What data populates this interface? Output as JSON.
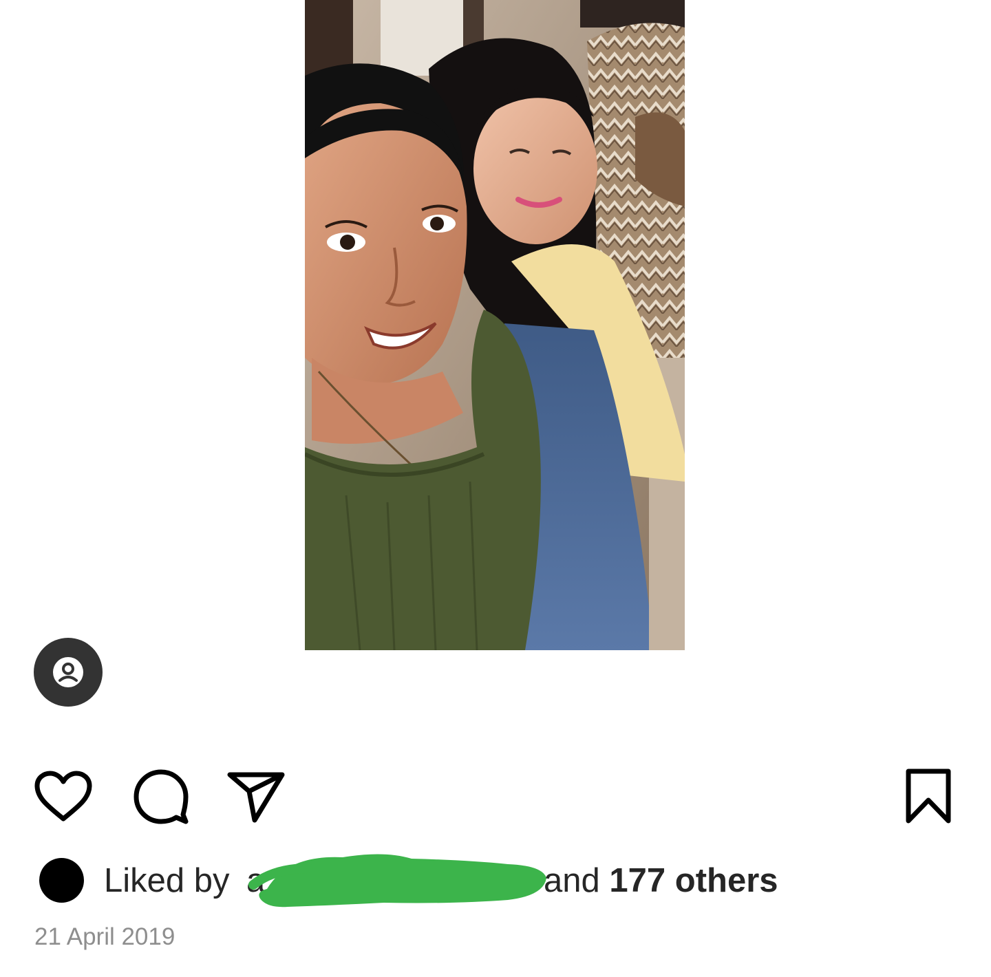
{
  "post": {
    "photo_icon": "post-photo-selfie",
    "tag_icon": "user-tag-icon",
    "actions": {
      "like_icon": "heart-icon",
      "comment_icon": "comment-bubble-icon",
      "share_icon": "paper-plane-icon",
      "save_icon": "bookmark-icon"
    },
    "likes": {
      "prefix": "Liked by",
      "first_liker": "a",
      "conjunction": "and",
      "others_count": "177 others"
    },
    "date": "21 April 2019"
  },
  "colors": {
    "text": "#262626",
    "muted": "#8e8e8e",
    "badge": "#333333",
    "redaction": "#3cb44b"
  }
}
